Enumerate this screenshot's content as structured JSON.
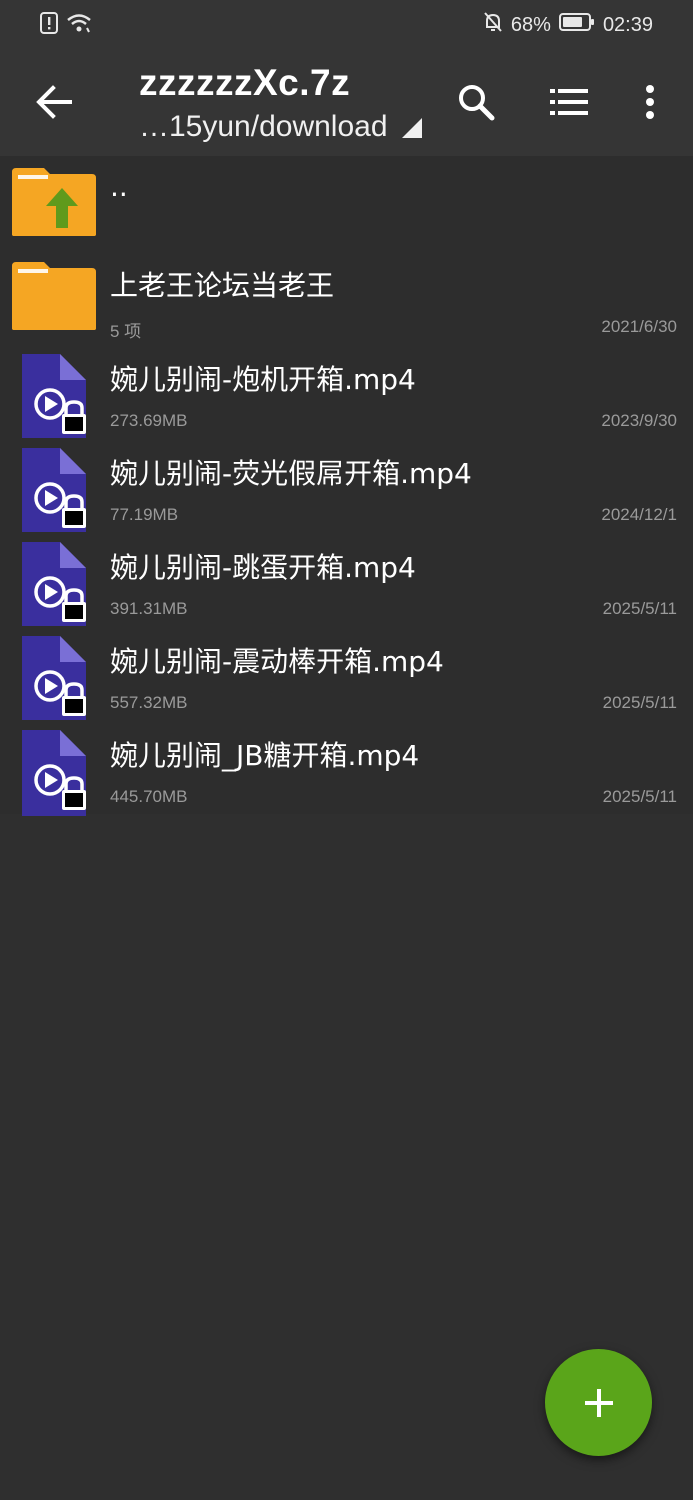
{
  "status_bar": {
    "battery_text": "68%",
    "time": "02:39"
  },
  "app_bar": {
    "title": "zzzzzzXc.7z",
    "path": "…15yun/download",
    "icons": [
      "back-arrow-icon",
      "search-icon",
      "list-view-icon",
      "more-vert-icon"
    ]
  },
  "files": {
    "parent": {
      "name": ".."
    },
    "folder": {
      "name": "上老王论坛当老王",
      "meta": "5 项",
      "date": "2021/6/30"
    },
    "items": [
      {
        "name": "婉儿别闹-炮机开箱.mp4",
        "size": "273.69MB",
        "date": "2023/9/30"
      },
      {
        "name": "婉儿别闹-荧光假屌开箱.mp4",
        "size": "77.19MB",
        "date": "2024/12/1"
      },
      {
        "name": "婉儿别闹-跳蛋开箱.mp4",
        "size": "391.31MB",
        "date": "2025/5/11"
      },
      {
        "name": "婉儿别闹-震动棒开箱.mp4",
        "size": "557.32MB",
        "date": "2025/5/11"
      },
      {
        "name": "婉儿别闹_JB糖开箱.mp4",
        "size": "445.70MB",
        "date": "2025/5/11"
      }
    ]
  },
  "colors": {
    "background": "#2f2f2f",
    "toolbar": "#353535",
    "folder": "#f5a623",
    "video_icon": "#3a2f9e",
    "fab": "#5aa51a",
    "up_arrow": "#5f9a1c"
  }
}
